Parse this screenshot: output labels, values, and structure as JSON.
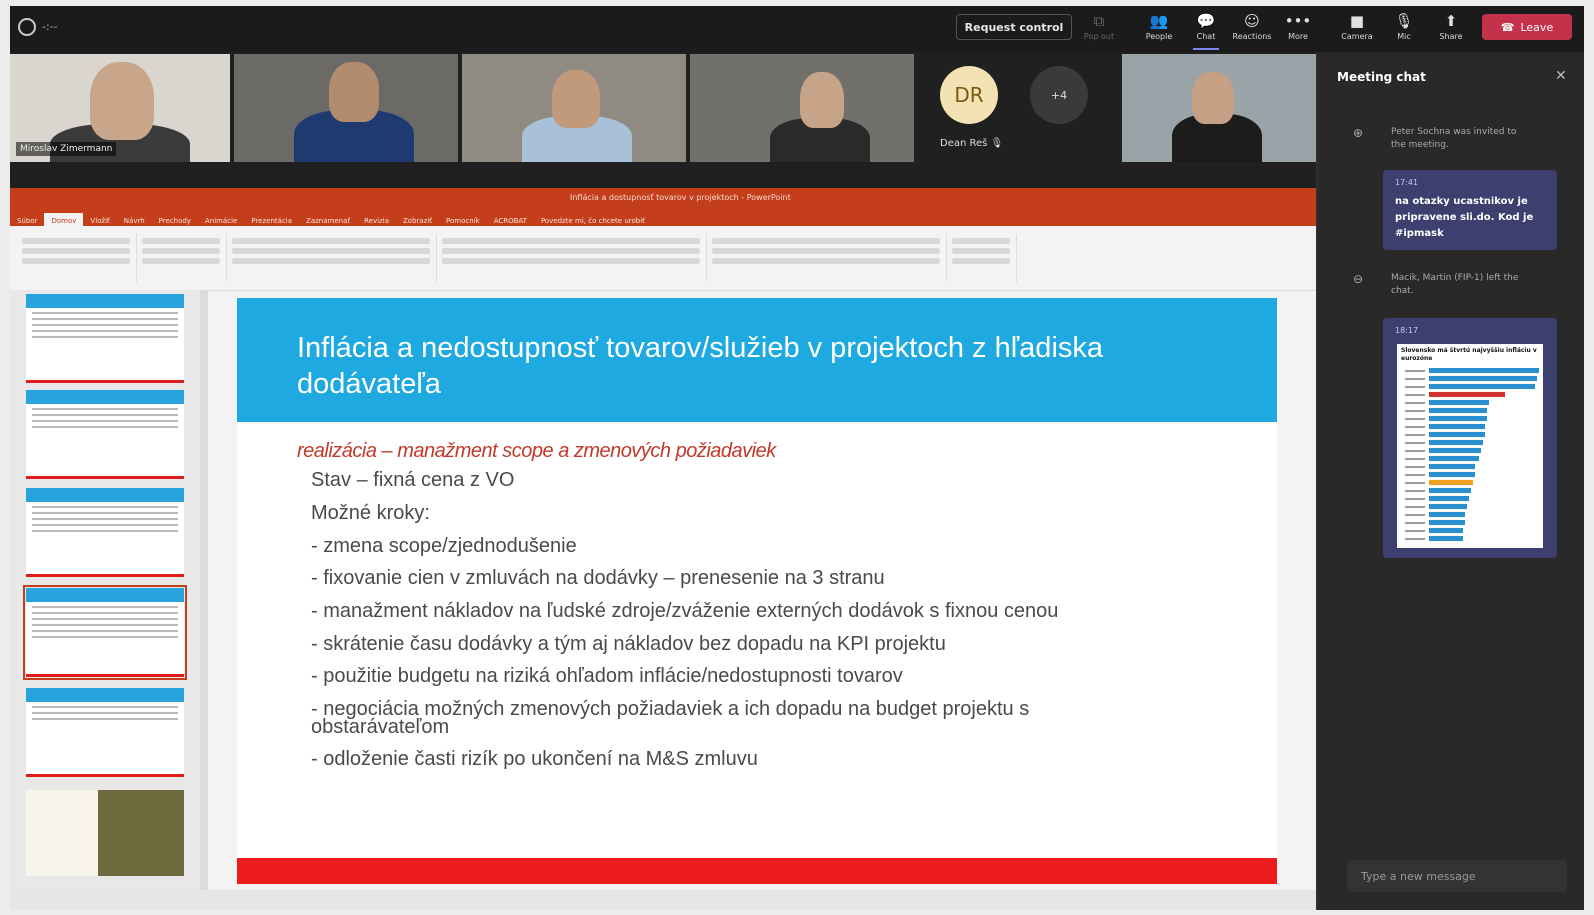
{
  "topbar": {
    "timer": "-:--",
    "request_control": "Request control",
    "items": [
      {
        "label": "Pop out",
        "icon": "pop-out-icon"
      },
      {
        "label": "People",
        "icon": "people-icon"
      },
      {
        "label": "Chat",
        "icon": "chat-icon"
      },
      {
        "label": "Reactions",
        "icon": "reactions-icon"
      },
      {
        "label": "More",
        "icon": "more-icon"
      },
      {
        "label": "Camera",
        "icon": "camera-icon"
      },
      {
        "label": "Mic",
        "icon": "mic-off-icon"
      },
      {
        "label": "Share",
        "icon": "share-icon"
      }
    ],
    "leave": "Leave"
  },
  "participants": {
    "tile1_name": "Miroslav Zimermann",
    "dr_initials": "DR",
    "dr_name": "Dean Reš",
    "more_count": "+4"
  },
  "ppt": {
    "window_title": "Inflácia a dostupnosť tovarov v projektoch - PowerPoint",
    "tabs": [
      "Súbor",
      "Domov",
      "Vložiť",
      "Návrh",
      "Prechody",
      "Animácie",
      "Prezentácia",
      "Zaznamenať",
      "Revízia",
      "Zobraziť",
      "Pomocník",
      "ACROBAT",
      "Povedzte mi, čo chcete urobiť"
    ],
    "slide": {
      "title": "Inflácia a nedostupnosť tovarov/služieb v projektoch z hľadiska dodávateľa",
      "subtitle": "realizácia – manažment scope a zmenových požiadaviek",
      "lines": [
        "Stav – fixná cena z VO",
        "Možné kroky:",
        "- zmena scope/zjednodušenie",
        "- fixovanie cien v zmluvách na dodávky – prenesenie na 3 stranu",
        "- manažment nákladov na ľudské zdroje/zváženie externých dodávok s fixnou cenou",
        "- skrátenie času dodávky a tým aj nákladov bez dopadu na KPI projektu",
        "- použitie budgetu na riziká ohľadom inflácie/nedostupnosti tovarov",
        "- negociácia možných zmenových požiadaviek a ich dopadu na budget projektu s",
        "obstarávateľom",
        "- odloženie časti rizík po ukončení na M&S zmluvu"
      ]
    }
  },
  "chat": {
    "title": "Meeting chat",
    "sys1": "Peter Sochna was invited to the meeting.",
    "msg1_time": "17:41",
    "msg1_text": "na otazky ucastnikov je pripravene sli.do. Kod je #ipmask",
    "sys2": "Macik, Martin (FIP-1) left the chat.",
    "msg2_time": "18:17",
    "msg2_chart_title": "Slovensko má štvrtú najvyššiu infláciu v eurozóne",
    "input_placeholder": "Type a new message"
  },
  "colors": {
    "accent": "#c43e1c",
    "slide_blue": "#1ea9e1",
    "slide_red": "#ee1c1c",
    "chat_bubble": "#3d3f6e",
    "leave": "#c4314b"
  }
}
